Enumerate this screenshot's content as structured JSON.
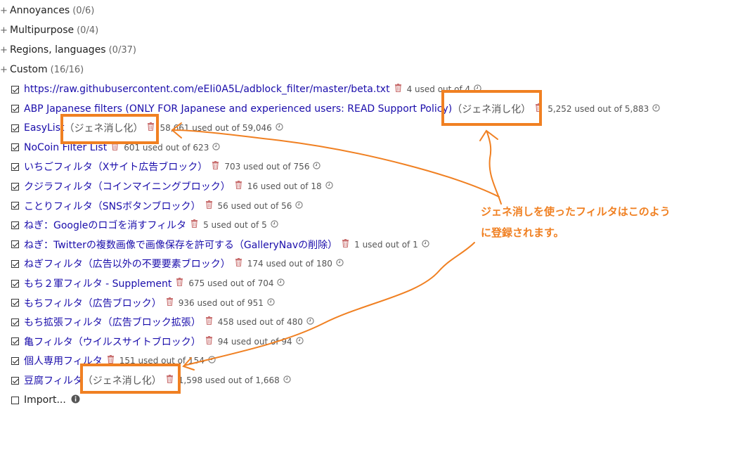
{
  "categories": [
    {
      "name": "Annoyances",
      "count": "(0/6)"
    },
    {
      "name": "Multipurpose",
      "count": "(0/4)"
    },
    {
      "name": "Regions, languages",
      "count": "(0/37)"
    },
    {
      "name": "Custom",
      "count": "(16/16)"
    }
  ],
  "filters": [
    {
      "name": "https://raw.githubusercontent.com/eEIi0A5L/adblock_filter/master/beta.txt",
      "stats": "4 used out of 4",
      "checked": true
    },
    {
      "name": "ABP Japanese filters (ONLY FOR Japanese and experienced users: READ Support Policy)",
      "suffix": "（ジェネ消し化）",
      "stats": "5,252 used out of 5,883",
      "checked": true
    },
    {
      "name": "EasyList",
      "suffix": "（ジェネ消し化）",
      "stats": "58,661 used out of 59,046",
      "checked": true
    },
    {
      "name": "NoCoin Filter List",
      "stats": "601 used out of 623",
      "checked": true
    },
    {
      "name": "いちごフィルタ（Xサイト広告ブロック）",
      "stats": "703 used out of 756",
      "checked": true
    },
    {
      "name": "クジラフィルタ（コインマイニングブロック）",
      "stats": "16 used out of 18",
      "checked": true
    },
    {
      "name": "ことりフィルタ（SNSボタンブロック）",
      "stats": "56 used out of 56",
      "checked": true
    },
    {
      "name": "ねぎ：Googleのロゴを消すフィルタ",
      "stats": "5 used out of 5",
      "checked": true
    },
    {
      "name": "ねぎ：Twitterの複数画像で画像保存を許可する（GalleryNavの削除）",
      "stats": "1 used out of 1",
      "checked": true
    },
    {
      "name": "ねぎフィルタ（広告以外の不要要素ブロック）",
      "stats": "174 used out of 180",
      "checked": true
    },
    {
      "name": "もち２軍フィルタ - Supplement",
      "stats": "675 used out of 704",
      "checked": true
    },
    {
      "name": "もちフィルタ（広告ブロック）",
      "stats": "936 used out of 951",
      "checked": true
    },
    {
      "name": "もち拡張フィルタ（広告ブロック拡張）",
      "stats": "458 used out of 480",
      "checked": true
    },
    {
      "name": "亀フィルタ（ウイルスサイトブロック）",
      "stats": "94 used out of 94",
      "checked": true
    },
    {
      "name": "個人専用フィルタ",
      "stats": "151 used out of 154",
      "checked": true
    },
    {
      "name": "豆腐フィルタ",
      "suffix": "（ジェネ消し化）",
      "stats": "1,598 used out of 1,668",
      "checked": true
    }
  ],
  "import_label": "Import...",
  "annotation": {
    "line1": "ジェネ消しを使ったフィルタはこのよう",
    "line2": "に登録されます。"
  },
  "icons": {
    "trash": "trash-icon",
    "clock": "clock-icon",
    "info": "info-icon"
  },
  "colors": {
    "link": "#1a0dab",
    "accent": "#f08022",
    "trash": "#c97070",
    "muted": "#666666"
  }
}
